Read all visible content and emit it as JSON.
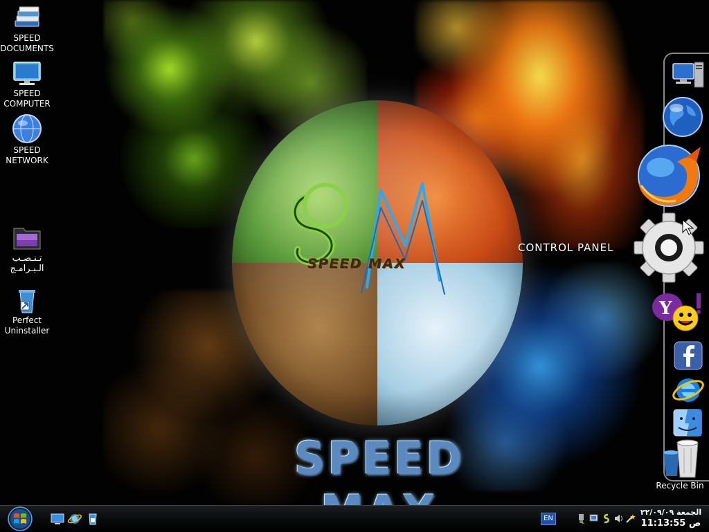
{
  "desktop_icons": [
    {
      "name": "speed-documents",
      "label": "SPEED\nDOCUMENTS",
      "line1": "SPEED",
      "line2": "DOCUMENTS"
    },
    {
      "name": "speed-computer",
      "line1": "SPEED",
      "line2": "COMPUTER"
    },
    {
      "name": "speed-network",
      "line1": "SPEED",
      "line2": "NETWORK"
    },
    {
      "name": "install-programs",
      "line1": "تـنـصـب",
      "line2": "الـبـرامـج"
    },
    {
      "name": "perfect-uninstaller",
      "line1": "Perfect",
      "line2": "Uninstaller"
    }
  ],
  "wallpaper": {
    "logo_small": "SPEED MAX",
    "logo_big": "SPEED MAX",
    "colors": {
      "earth_green": "#3f8a1c",
      "fire_orange": "#c84a16",
      "soil_brown": "#7a5228",
      "ice_blue": "#a8cfe4"
    }
  },
  "dock": {
    "items": [
      {
        "name": "computer",
        "icon": "computer-icon"
      },
      {
        "name": "globe",
        "icon": "globe-icon"
      },
      {
        "name": "firefox",
        "icon": "firefox-icon"
      },
      {
        "name": "control-panel",
        "icon": "gear-icon"
      },
      {
        "name": "yahoo-messenger",
        "icon": "yahoo-messenger-icon"
      },
      {
        "name": "facebook",
        "icon": "facebook-icon"
      },
      {
        "name": "internet-explorer",
        "icon": "internet-explorer-icon"
      },
      {
        "name": "finder",
        "icon": "finder-icon"
      },
      {
        "name": "recycle-bin",
        "icon": "recycle-bin-icon"
      }
    ],
    "hover_label": "CONTROL PANEL",
    "recycle_bin_label": "Recycle Bin"
  },
  "taskbar": {
    "language": "EN",
    "clock": {
      "day_date": "الجمعة ٢٢/٠٩/٠٩",
      "time_line": "ص 11:13:55"
    }
  }
}
